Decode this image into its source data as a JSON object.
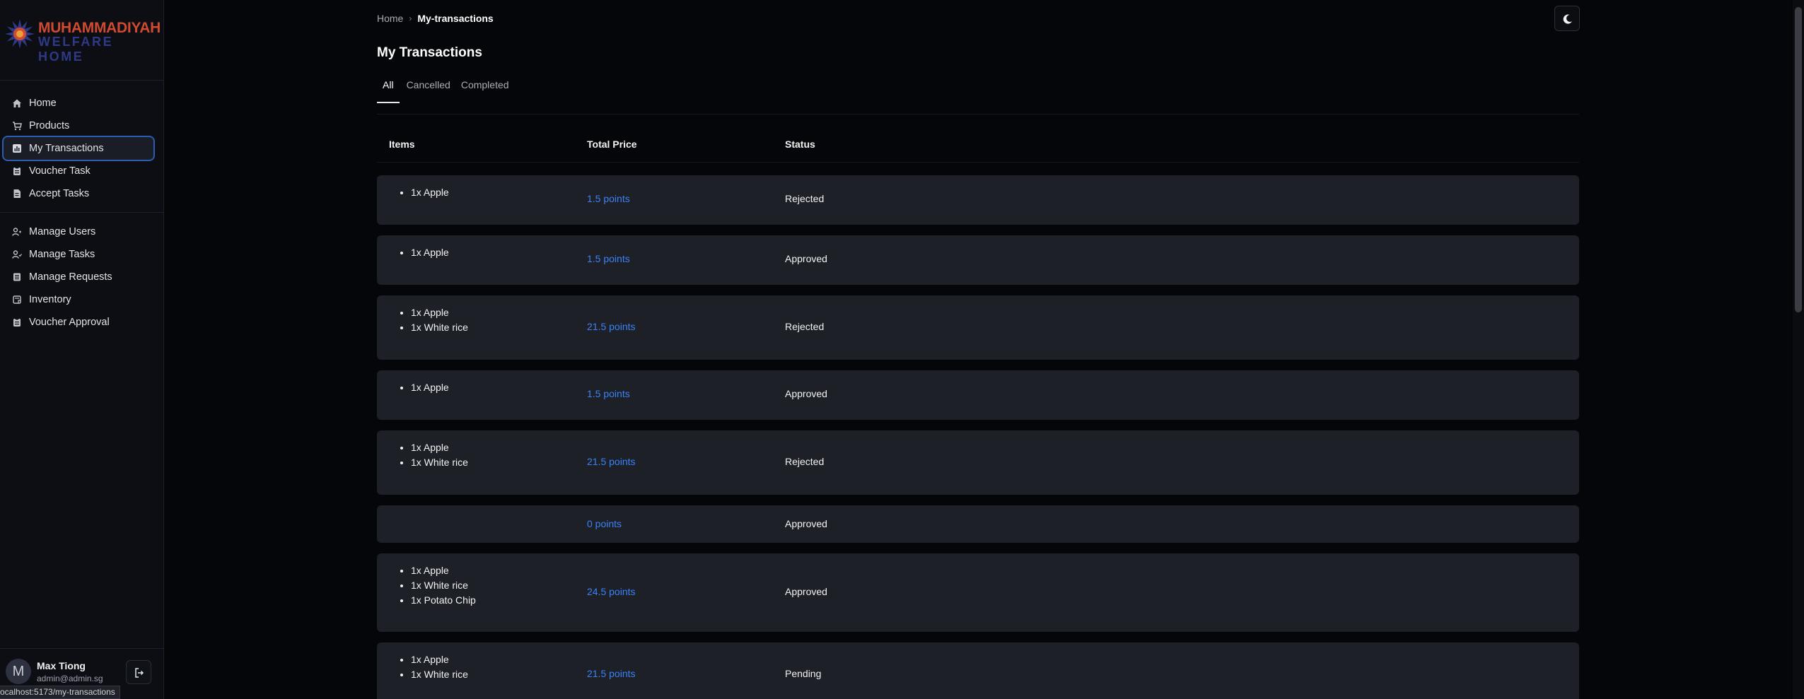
{
  "brand": {
    "line1": "MUHAMMADIYAH",
    "line2": "WELFARE HOME"
  },
  "nav_primary": [
    {
      "label": "Home",
      "icon": "home-icon"
    },
    {
      "label": "Products",
      "icon": "cart-icon"
    },
    {
      "label": "My Transactions",
      "icon": "chart-icon",
      "active": true
    },
    {
      "label": "Voucher Task",
      "icon": "clipboard-icon"
    },
    {
      "label": "Accept Tasks",
      "icon": "file-icon"
    }
  ],
  "nav_admin": [
    {
      "label": "Manage Users",
      "icon": "users-icon"
    },
    {
      "label": "Manage Tasks",
      "icon": "users-icon"
    },
    {
      "label": "Manage Requests",
      "icon": "list-icon"
    },
    {
      "label": "Inventory",
      "icon": "box-icon"
    },
    {
      "label": "Voucher Approval",
      "icon": "clipboard-icon"
    }
  ],
  "user": {
    "initial": "M",
    "name": "Max Tiong",
    "email": "admin@admin.sg"
  },
  "status_url": "ocalhost:5173/my-transactions",
  "breadcrumb": {
    "home": "Home",
    "current": "My-transactions"
  },
  "page_title": "My Transactions",
  "tabs": [
    {
      "label": "All",
      "active": true
    },
    {
      "label": "Cancelled"
    },
    {
      "label": "Completed"
    }
  ],
  "table": {
    "headers": {
      "items": "Items",
      "price": "Total Price",
      "status": "Status"
    },
    "rows": [
      {
        "items": [
          "1x Apple"
        ],
        "price": "1.5 points",
        "status": "Rejected"
      },
      {
        "items": [
          "1x Apple"
        ],
        "price": "1.5 points",
        "status": "Approved"
      },
      {
        "items": [
          "1x Apple",
          "1x White rice"
        ],
        "price": "21.5 points",
        "status": "Rejected"
      },
      {
        "items": [
          "1x Apple"
        ],
        "price": "1.5 points",
        "status": "Approved"
      },
      {
        "items": [
          "1x Apple",
          "1x White rice"
        ],
        "price": "21.5 points",
        "status": "Rejected"
      },
      {
        "items": [],
        "price": "0 points",
        "status": "Approved"
      },
      {
        "items": [
          "1x Apple",
          "1x White rice",
          "1x Potato Chip"
        ],
        "price": "24.5 points",
        "status": "Approved"
      },
      {
        "items": [
          "1x Apple",
          "1x White rice"
        ],
        "price": "21.5 points",
        "status": "Pending"
      }
    ]
  },
  "colors": {
    "accent_link": "#3b82f6",
    "active_outline": "#2a5db3",
    "brand_red": "#d04a30",
    "brand_blue": "#2e3a86"
  }
}
